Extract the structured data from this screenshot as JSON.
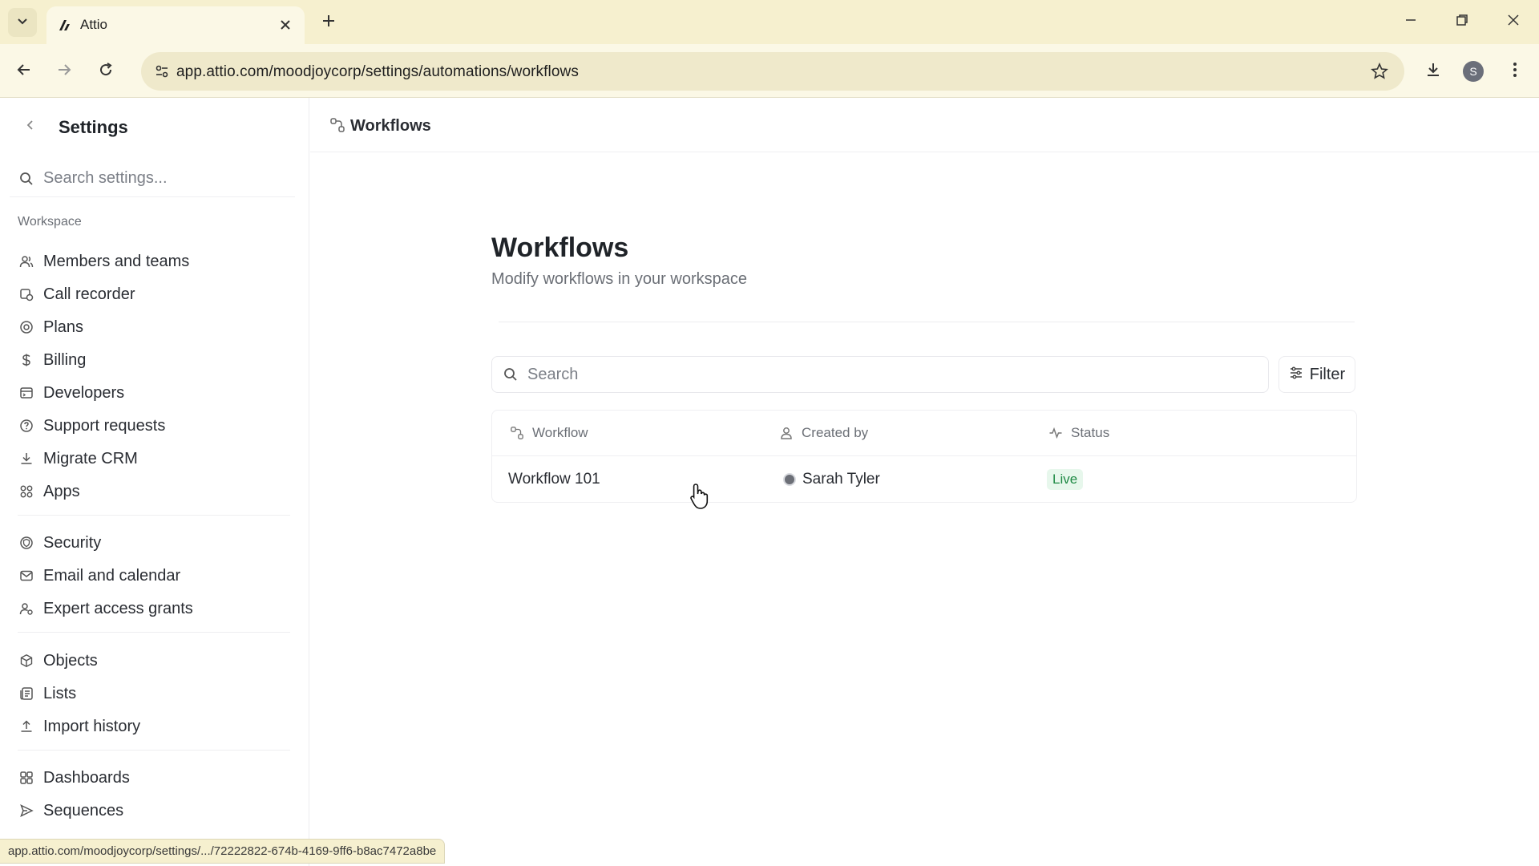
{
  "browser": {
    "tab_title": "Attio",
    "url": "app.attio.com/moodjoycorp/settings/automations/workflows",
    "profile_initial": "S",
    "status_url": "app.attio.com/moodjoycorp/settings/.../72222822-674b-4169-9ff6-b8ac7472a8be"
  },
  "sidebar": {
    "title": "Settings",
    "search_placeholder": "Search settings...",
    "workspace_label": "Workspace",
    "group1": [
      {
        "label": "Members and teams",
        "icon": "users-icon"
      },
      {
        "label": "Call recorder",
        "icon": "call-recorder-icon"
      },
      {
        "label": "Plans",
        "icon": "plans-icon"
      },
      {
        "label": "Billing",
        "icon": "dollar-icon"
      },
      {
        "label": "Developers",
        "icon": "developers-icon"
      },
      {
        "label": "Support requests",
        "icon": "help-icon"
      },
      {
        "label": "Migrate CRM",
        "icon": "download-icon"
      },
      {
        "label": "Apps",
        "icon": "apps-icon"
      }
    ],
    "group2": [
      {
        "label": "Security",
        "icon": "security-icon"
      },
      {
        "label": "Email and calendar",
        "icon": "mail-icon"
      },
      {
        "label": "Expert access grants",
        "icon": "expert-access-icon"
      }
    ],
    "group3": [
      {
        "label": "Objects",
        "icon": "cube-icon"
      },
      {
        "label": "Lists",
        "icon": "lists-icon"
      },
      {
        "label": "Import history",
        "icon": "upload-icon"
      }
    ],
    "group4": [
      {
        "label": "Dashboards",
        "icon": "dashboards-icon"
      },
      {
        "label": "Sequences",
        "icon": "send-icon"
      }
    ]
  },
  "header": {
    "title": "Workflows"
  },
  "main": {
    "title": "Workflows",
    "subtitle": "Modify workflows in your workspace",
    "search_placeholder": "Search",
    "filter_label": "Filter",
    "columns": {
      "workflow": "Workflow",
      "created_by": "Created by",
      "status": "Status"
    },
    "rows": [
      {
        "workflow": "Workflow 101",
        "created_by": "Sarah Tyler",
        "status": "Live"
      }
    ]
  },
  "colors": {
    "tab_strip": "#f6f0cf",
    "status_live_text": "#1f8a45",
    "status_live_bg": "#e7f7ec"
  }
}
